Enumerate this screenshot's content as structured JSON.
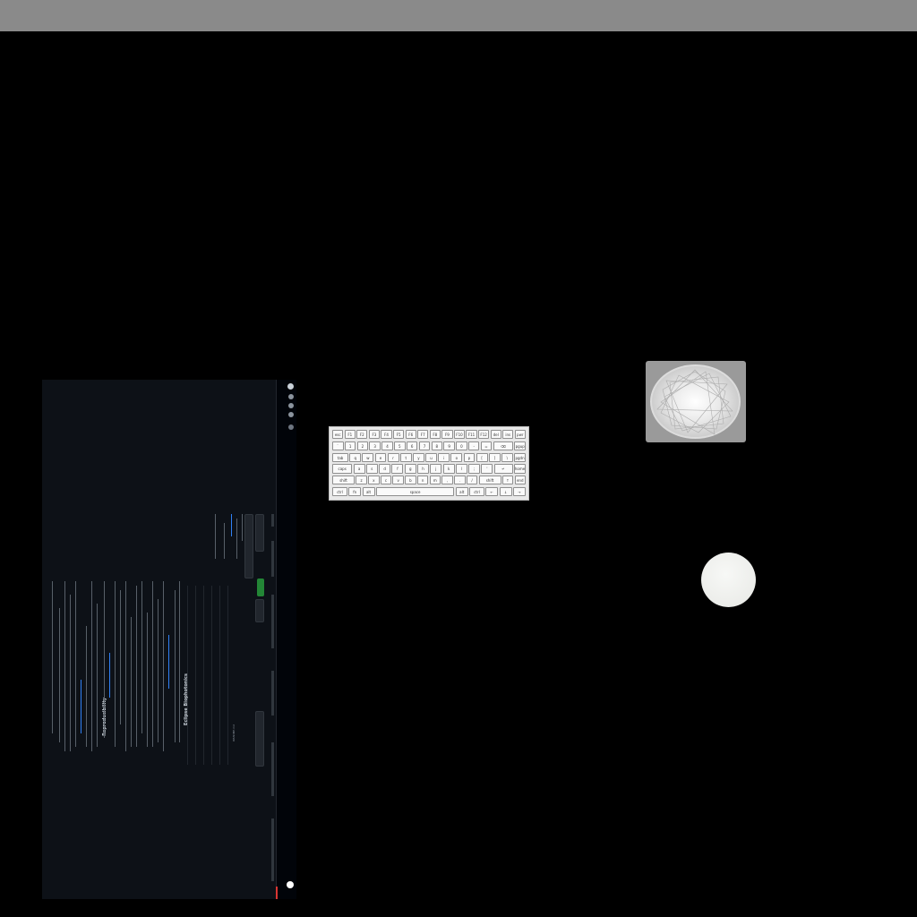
{
  "colors": {
    "top_bar": "#8a8a8a",
    "background": "#000000",
    "screen_bg": "#0d1117",
    "accent_green": "#238636",
    "link_blue": "#2f81f7",
    "keyboard_bg": "#e8e8e8",
    "orb_card": "#9a9a9a",
    "white_dot": "#eeefec"
  },
  "screen": {
    "repo_heading": "Eclipse Biophotonics",
    "readme_heading": "Reproducibility",
    "code_button": "Code",
    "icons": [
      "github-logo-icon",
      "search-icon",
      "bell-icon",
      "plus-icon",
      "avatar-icon"
    ]
  },
  "keyboard": {
    "rows": [
      [
        "esc",
        "F1",
        "F2",
        "F3",
        "F4",
        "F5",
        "F6",
        "F7",
        "F8",
        "F9",
        "F10",
        "F11",
        "F12",
        "del",
        "ins",
        "pwr"
      ],
      [
        "`",
        "1",
        "2",
        "3",
        "4",
        "5",
        "6",
        "7",
        "8",
        "9",
        "0",
        "-",
        "=",
        "⌫",
        "pgup"
      ],
      [
        "tab",
        "q",
        "w",
        "e",
        "r",
        "t",
        "y",
        "u",
        "i",
        "o",
        "p",
        "[",
        "]",
        "\\",
        "pgdn"
      ],
      [
        "caps",
        "a",
        "s",
        "d",
        "f",
        "g",
        "h",
        "j",
        "k",
        "l",
        ";",
        "'",
        "↵",
        "home"
      ],
      [
        "shift",
        "z",
        "x",
        "c",
        "v",
        "b",
        "n",
        "m",
        ",",
        ".",
        "/",
        "shift",
        "↑",
        "end"
      ],
      [
        "ctrl",
        "fn",
        "alt",
        "space",
        "alt",
        "ctrl",
        "←",
        "↓",
        "→"
      ]
    ]
  }
}
